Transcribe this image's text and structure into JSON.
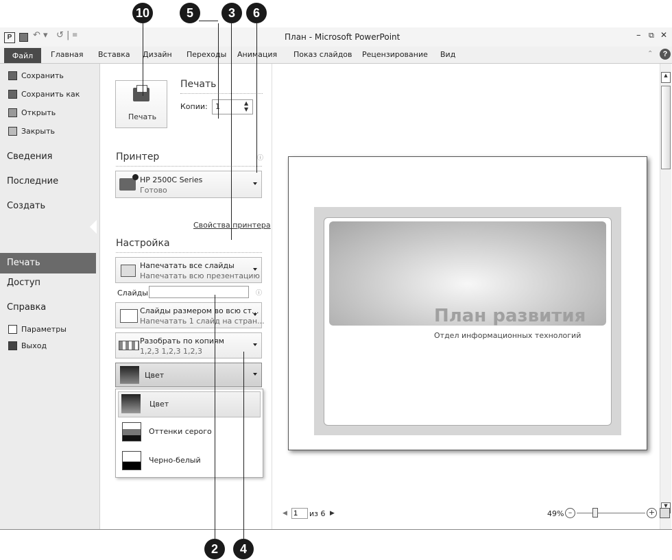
{
  "callouts": {
    "c10": "10",
    "c5": "5",
    "c3": "3",
    "c6": "6",
    "c2": "2",
    "c4": "4"
  },
  "window": {
    "title": "План - Microsoft PowerPoint"
  },
  "ribbon": {
    "tabs": [
      "Файл",
      "Главная",
      "Вставка",
      "Дизайн",
      "Переходы",
      "Анимация",
      "Показ слайдов",
      "Рецензирование",
      "Вид"
    ]
  },
  "sidebar": {
    "small": [
      "Сохранить",
      "Сохранить как",
      "Открыть",
      "Закрыть"
    ],
    "big": [
      "Сведения",
      "Последние",
      "Создать",
      "Печать",
      "Доступ",
      "Справка"
    ],
    "bottom": [
      "Параметры",
      "Выход"
    ]
  },
  "print": {
    "button_label": "Печать",
    "header": "Печать",
    "copies_label": "Копии:",
    "copies_value": "1",
    "printer_section": "Принтер",
    "printer_name": "HP 2500C Series",
    "printer_status": "Готово",
    "printer_props": "Свойства принтера",
    "settings_section": "Настройка",
    "range_title": "Напечатать все слайды",
    "range_sub": "Напечатать всю презентацию",
    "slides_label": "Слайды:",
    "slides_value": "",
    "layout_title": "Слайды размером во всю ст...",
    "layout_sub": "Напечатать 1 слайд на стран...",
    "collate_title": "Разобрать по копиям",
    "collate_sub": "1,2,3   1,2,3   1,2,3",
    "color_selected": "Цвет",
    "color_options": [
      "Цвет",
      "Оттенки серого",
      "Черно-белый"
    ]
  },
  "slide": {
    "title": "План развития",
    "subtitle": "Отдел информационных технологий"
  },
  "status": {
    "page": "1",
    "page_of": "из 6",
    "zoom": "49%"
  },
  "icons": [
    "printer-icon",
    "save-icon",
    "save-as-icon",
    "open-icon",
    "close-icon",
    "options-icon",
    "exit-icon",
    "info-icon",
    "chevron-down-icon",
    "zoom-out-icon",
    "zoom-in-icon",
    "fit-icon"
  ]
}
